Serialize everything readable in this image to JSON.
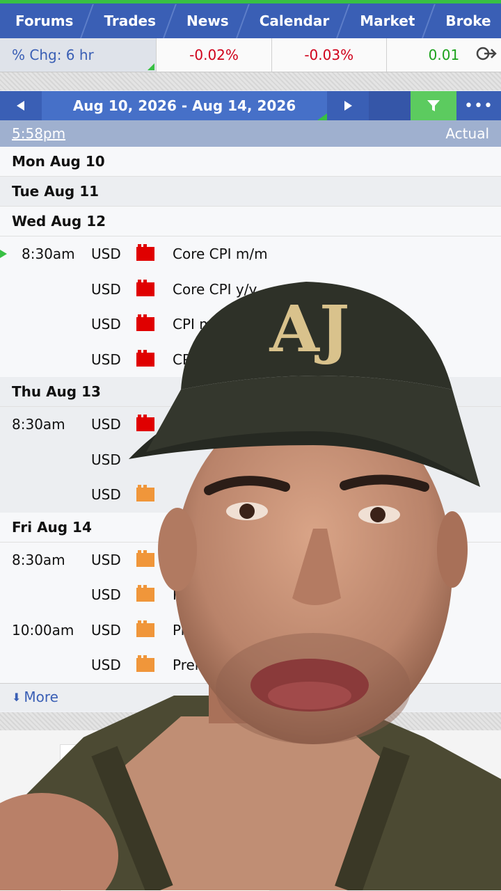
{
  "nav": {
    "tabs": [
      "Forums",
      "Trades",
      "News",
      "Calendar",
      "Market",
      "Broke"
    ]
  },
  "change_bar": {
    "label": "% Chg: 6 hr",
    "values": [
      "-0.02%",
      "-0.03%",
      "0.01"
    ],
    "icon": "exit-icon"
  },
  "date_bar": {
    "range": "Aug 10, 2026 - Aug 14, 2026",
    "prev_icon": "prev-week-icon",
    "next_icon": "next-week-icon",
    "filter_icon": "filter-icon",
    "more_icon": "more-dots-icon"
  },
  "time_bar": {
    "time": "5:58pm",
    "actual_label": "Actual"
  },
  "calendar": {
    "days": [
      {
        "label": "Mon Aug 10",
        "events": []
      },
      {
        "label": "Tue Aug 11",
        "events": []
      },
      {
        "label": "Wed Aug 12",
        "events": [
          {
            "time": "8:30am",
            "currency": "USD",
            "impact": "high",
            "title": "Core CPI m/m",
            "next": true
          },
          {
            "time": "",
            "currency": "USD",
            "impact": "high",
            "title": "Core CPI y/y"
          },
          {
            "time": "",
            "currency": "USD",
            "impact": "high",
            "title": "CPI m/m"
          },
          {
            "time": "",
            "currency": "USD",
            "impact": "high",
            "title": "CPI"
          }
        ]
      },
      {
        "label": "Thu Aug 13",
        "events": [
          {
            "time": "8:30am",
            "currency": "USD",
            "impact": "high",
            "title": ""
          },
          {
            "time": "",
            "currency": "USD",
            "impact": "none",
            "title": ""
          },
          {
            "time": "",
            "currency": "USD",
            "impact": "medium",
            "title": ""
          }
        ]
      },
      {
        "label": "Fri Aug 14",
        "events": [
          {
            "time": "8:30am",
            "currency": "USD",
            "impact": "medium",
            "title": ""
          },
          {
            "time": "",
            "currency": "USD",
            "impact": "medium",
            "title": "Re"
          },
          {
            "time": "10:00am",
            "currency": "USD",
            "impact": "medium",
            "title": "Pre"
          },
          {
            "time": "",
            "currency": "USD",
            "impact": "medium",
            "title": "Prel"
          }
        ]
      }
    ],
    "more_label": "More"
  },
  "overlay": {
    "cap_logo": "AJ"
  },
  "colors": {
    "nav_blue": "#3a5fb5",
    "accent_green": "#38c043",
    "negative_red": "#d0021b",
    "high_impact": "#e00000",
    "medium_impact": "#f0963a"
  }
}
